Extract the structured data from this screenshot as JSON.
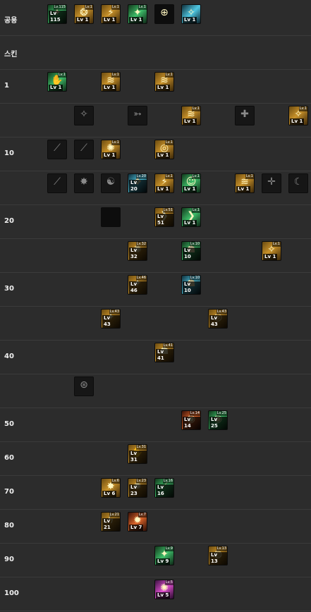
{
  "rows": [
    {
      "label": "공용",
      "slots": [
        {
          "glyph": "✦",
          "tone": "green",
          "level": "Lv 115",
          "tag": "Lv.115"
        },
        {
          "glyph": "❂",
          "tone": "gold",
          "level": "Lv 1",
          "tag": "Lv.1"
        },
        {
          "glyph": "⚡",
          "tone": "gold",
          "level": "Lv 1",
          "tag": "Lv.1"
        },
        {
          "glyph": "✦",
          "tone": "green",
          "level": "Lv 1",
          "tag": "Lv.1"
        },
        {
          "glyph": "⊕",
          "tone": "black",
          "level": "",
          "tag": ""
        },
        {
          "glyph": "✧",
          "tone": "blue",
          "level": "Lv 1",
          "tag": ""
        }
      ]
    },
    {
      "label": "스킨",
      "slots": []
    },
    {
      "label": "1",
      "slots": [
        {
          "glyph": "✋",
          "tone": "green",
          "level": "Lv 1",
          "tag": "Lv.1"
        },
        {
          "glyph": "≋",
          "tone": "gold",
          "level": "Lv 1",
          "tag": "Lv.1"
        },
        {
          "glyph": "≋",
          "tone": "gold",
          "level": "Lv 1",
          "tag": "Lv.1"
        }
      ]
    },
    {
      "label": "",
      "slots": [
        {
          "glyph": "✧",
          "tone": "dark",
          "level": "",
          "tag": ""
        },
        {
          "glyph": "➳",
          "tone": "dark",
          "level": "",
          "tag": ""
        },
        {
          "glyph": "≋",
          "tone": "gold",
          "level": "Lv 1",
          "tag": "Lv.1"
        },
        {
          "glyph": "✚",
          "tone": "dark",
          "level": "",
          "tag": ""
        },
        {
          "glyph": "✧",
          "tone": "gold",
          "level": "Lv 1",
          "tag": "Lv.1"
        }
      ]
    },
    {
      "label": "10",
      "slots": [
        {
          "glyph": "⟋",
          "tone": "dark",
          "level": "",
          "tag": ""
        },
        {
          "glyph": "⟋",
          "tone": "dark",
          "level": "",
          "tag": ""
        },
        {
          "glyph": "✺",
          "tone": "gold",
          "level": "Lv 1",
          "tag": "Lv.1"
        },
        {
          "glyph": "◎",
          "tone": "gold",
          "level": "Lv 1",
          "tag": "Lv.1"
        }
      ]
    },
    {
      "label": "",
      "slots": [
        {
          "glyph": "⟋",
          "tone": "dark",
          "level": "",
          "tag": ""
        },
        {
          "glyph": "✸",
          "tone": "dark",
          "level": "",
          "tag": ""
        },
        {
          "glyph": "☯",
          "tone": "dark",
          "level": "",
          "tag": ""
        },
        {
          "glyph": "❖",
          "tone": "blue",
          "level": "Lv 20",
          "tag": "Lv.20"
        },
        {
          "glyph": "⚡",
          "tone": "gold",
          "level": "Lv 1",
          "tag": "Lv.1"
        },
        {
          "glyph": "☺",
          "tone": "green",
          "level": "Lv 1",
          "tag": "Lv.1"
        },
        {
          "glyph": "≋",
          "tone": "gold",
          "level": "Lv 1",
          "tag": "Lv.1"
        },
        {
          "glyph": "✛",
          "tone": "dark",
          "level": "",
          "tag": ""
        },
        {
          "glyph": "☾",
          "tone": "dark",
          "level": "",
          "tag": ""
        }
      ]
    },
    {
      "label": "20",
      "slots": [
        {
          "glyph": "",
          "tone": "black",
          "level": "",
          "tag": ""
        },
        {
          "glyph": "❯",
          "tone": "gold",
          "level": "Lv 51",
          "tag": "Lv.51"
        },
        {
          "glyph": "❯",
          "tone": "green",
          "level": "Lv 1",
          "tag": "Lv.1"
        }
      ]
    },
    {
      "label": "",
      "slots": [
        {
          "glyph": "✺",
          "tone": "gold",
          "level": "Lv 32",
          "tag": "Lv.32"
        },
        {
          "glyph": "☗",
          "tone": "green",
          "level": "Lv 10",
          "tag": "Lv.10"
        },
        {
          "glyph": "✧",
          "tone": "gold",
          "level": "Lv 1",
          "tag": "Lv.1"
        }
      ]
    },
    {
      "label": "30",
      "slots": [
        {
          "glyph": "✦",
          "tone": "gold",
          "level": "Lv 46",
          "tag": "Lv.46"
        },
        {
          "glyph": "☗",
          "tone": "blue",
          "level": "Lv 10",
          "tag": "Lv.10"
        }
      ]
    },
    {
      "label": "",
      "slots": [
        {
          "glyph": "✦",
          "tone": "gold",
          "level": "Lv 43",
          "tag": "Lv.43"
        },
        {
          "glyph": "◎",
          "tone": "gold",
          "level": "Lv 43",
          "tag": "Lv.43"
        }
      ]
    },
    {
      "label": "40",
      "slots": [
        {
          "glyph": "☗",
          "tone": "gold",
          "level": "Lv 41",
          "tag": "Lv.41"
        }
      ]
    },
    {
      "label": "",
      "slots": [
        {
          "glyph": "⊛",
          "tone": "dark",
          "level": "",
          "tag": ""
        }
      ]
    },
    {
      "label": "50",
      "slots": [
        {
          "glyph": "◉",
          "tone": "red",
          "level": "Lv 14",
          "tag": "Lv.14"
        },
        {
          "glyph": "◉",
          "tone": "green",
          "level": "Lv 25",
          "tag": "Lv.25"
        }
      ]
    },
    {
      "label": "60",
      "slots": [
        {
          "glyph": "✋",
          "tone": "gold",
          "level": "Lv 31",
          "tag": "Lv.31"
        }
      ]
    },
    {
      "label": "70",
      "slots": [
        {
          "glyph": "✸",
          "tone": "gold",
          "level": "Lv 6",
          "tag": "Lv.6"
        },
        {
          "glyph": "✹",
          "tone": "gold",
          "level": "Lv 23",
          "tag": "Lv.23"
        },
        {
          "glyph": "⟋",
          "tone": "green",
          "level": "Lv 16",
          "tag": "Lv.16"
        }
      ]
    },
    {
      "label": "80",
      "slots": [
        {
          "glyph": "ϟ",
          "tone": "gold",
          "level": "Lv 21",
          "tag": "Lv.21"
        },
        {
          "glyph": "✹",
          "tone": "red",
          "level": "Lv 7",
          "tag": "Lv.7"
        }
      ]
    },
    {
      "label": "90",
      "slots": [
        {
          "glyph": "✦",
          "tone": "green",
          "level": "Lv 9",
          "tag": "Lv.9"
        },
        {
          "glyph": "◍",
          "tone": "gold",
          "level": "Lv 13",
          "tag": "Lv.13"
        }
      ]
    },
    {
      "label": "100",
      "slots": [
        {
          "glyph": "✺",
          "tone": "pink",
          "level": "Lv 5",
          "tag": "Lv.5"
        }
      ]
    }
  ]
}
